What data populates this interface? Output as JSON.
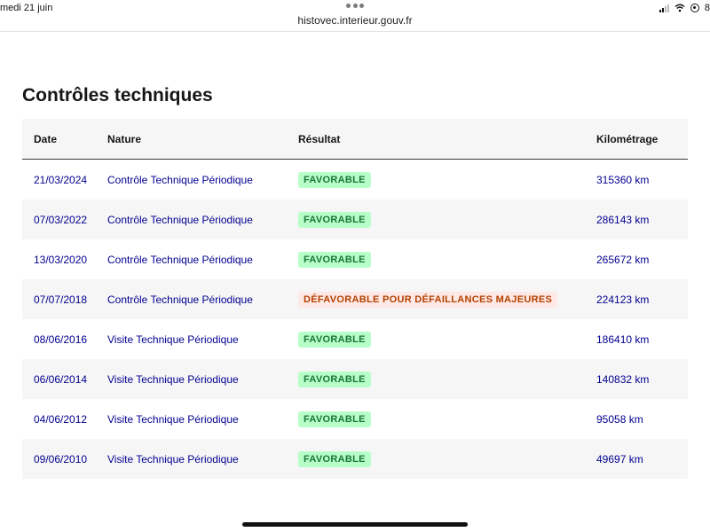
{
  "status": {
    "time": "medi 21 juin",
    "battery": "8"
  },
  "browser": {
    "url": "histovec.interieur.gouv.fr"
  },
  "page": {
    "title": "Contrôles techniques"
  },
  "table": {
    "headers": {
      "date": "Date",
      "nature": "Nature",
      "result": "Résultat",
      "mileage": "Kilométrage"
    },
    "rows": [
      {
        "date": "21/03/2024",
        "nature": "Contrôle Technique Périodique",
        "result": "FAVORABLE",
        "result_status": "favorable",
        "mileage": "315360 km"
      },
      {
        "date": "07/03/2022",
        "nature": "Contrôle Technique Périodique",
        "result": "FAVORABLE",
        "result_status": "favorable",
        "mileage": "286143 km"
      },
      {
        "date": "13/03/2020",
        "nature": "Contrôle Technique Périodique",
        "result": "FAVORABLE",
        "result_status": "favorable",
        "mileage": "265672 km"
      },
      {
        "date": "07/07/2018",
        "nature": "Contrôle Technique Périodique",
        "result": "DÉFAVORABLE POUR DÉFAILLANCES MAJEURES",
        "result_status": "defavorable",
        "mileage": "224123 km"
      },
      {
        "date": "08/06/2016",
        "nature": "Visite Technique Périodique",
        "result": "FAVORABLE",
        "result_status": "favorable",
        "mileage": "186410 km"
      },
      {
        "date": "06/06/2014",
        "nature": "Visite Technique Périodique",
        "result": "FAVORABLE",
        "result_status": "favorable",
        "mileage": "140832 km"
      },
      {
        "date": "04/06/2012",
        "nature": "Visite Technique Périodique",
        "result": "FAVORABLE",
        "result_status": "favorable",
        "mileage": "95058 km"
      },
      {
        "date": "09/06/2010",
        "nature": "Visite Technique Périodique",
        "result": "FAVORABLE",
        "result_status": "favorable",
        "mileage": "49697 km"
      }
    ]
  },
  "colors": {
    "link": "#000091",
    "favorable_bg": "#b8fec9",
    "favorable_text": "#18753c",
    "defavorable_bg": "#ffe9e6",
    "defavorable_text": "#b34000"
  },
  "icons": {
    "signal": "signal-icon",
    "wifi": "wifi-icon",
    "location": "location-icon"
  }
}
